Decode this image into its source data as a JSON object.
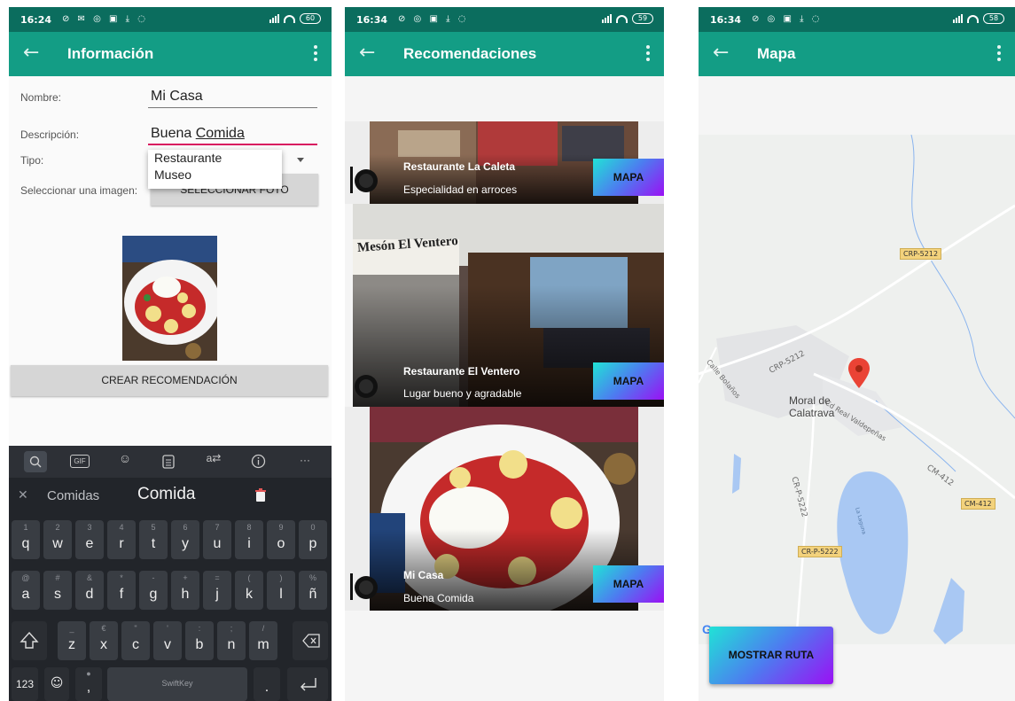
{
  "colors": {
    "status_bar": "#0b6d5e",
    "app_bar": "#139d85",
    "accent_underline": "#d81b60",
    "gradient": [
      "#20e3d6",
      "#4d7bf0",
      "#9b10f4"
    ],
    "keyboard_bg": "#22252a"
  },
  "screens": [
    {
      "status": {
        "time": "16:24",
        "battery": "60"
      },
      "title": "Información",
      "form": {
        "name_label": "Nombre:",
        "name_value": "Mi Casa",
        "desc_label": "Descripción:",
        "desc_value_plain": "Buena ",
        "desc_value_underlined": "Comida",
        "type_label": "Tipo:",
        "type_options": [
          "Restaurante",
          "Museo"
        ],
        "image_label": "Seleccionar una imagen:",
        "select_photo_button": "SELECCIONAR FOTO",
        "create_button": "CREAR RECOMENDACIÓN"
      },
      "keyboard": {
        "suggestions": [
          "Comidas",
          "Comida"
        ],
        "row1": [
          [
            "1",
            "q"
          ],
          [
            "2",
            "w"
          ],
          [
            "3",
            "e"
          ],
          [
            "4",
            "r"
          ],
          [
            "5",
            "t"
          ],
          [
            "6",
            "y"
          ],
          [
            "7",
            "u"
          ],
          [
            "8",
            "i"
          ],
          [
            "9",
            "o"
          ],
          [
            "0",
            "p"
          ]
        ],
        "row2": [
          [
            "@",
            "a"
          ],
          [
            "#",
            "s"
          ],
          [
            "&",
            "d"
          ],
          [
            "*",
            "f"
          ],
          [
            "-",
            "g"
          ],
          [
            "+",
            "h"
          ],
          [
            "=",
            "j"
          ],
          [
            "(",
            "k"
          ],
          [
            ")",
            "l"
          ],
          [
            "%",
            "ñ"
          ]
        ],
        "row3": [
          [
            "_",
            "z"
          ],
          [
            "€",
            "x"
          ],
          [
            "\"",
            "c"
          ],
          [
            "'",
            "v"
          ],
          [
            ":",
            "b"
          ],
          [
            ";",
            "n"
          ],
          [
            "/",
            "m"
          ]
        ],
        "numbers_key": "123",
        "space_label": "SwiftKey",
        "period_key": ".",
        "comma_key": ","
      }
    },
    {
      "status": {
        "time": "16:34",
        "battery": "59"
      },
      "title": "Recomendaciones",
      "cards": [
        {
          "title": "Restaurante La Caleta",
          "description": "Especialidad en arroces",
          "button": "MAPA"
        },
        {
          "title": "Restaurante El Ventero",
          "description": "Lugar bueno y agradable",
          "button": "MAPA",
          "sign_text": "Mesón El Ventero"
        },
        {
          "title": "Mi Casa",
          "description": "Buena Comida",
          "button": "MAPA"
        }
      ]
    },
    {
      "status": {
        "time": "16:34",
        "battery": "58"
      },
      "title": "Mapa",
      "map": {
        "town": [
          "Moral de",
          "Calatrava"
        ],
        "labels": [
          "Calle Bolaños",
          "CRP-5212",
          "Cd Real Valdepeñas",
          "CR-P-5222",
          "CM-412",
          "La Laguna"
        ],
        "shields": [
          "CRP-5212",
          "CM-412",
          "CR-P-5222"
        ],
        "watermark": "G"
      },
      "route_button": "MOSTRAR RUTA"
    }
  ]
}
